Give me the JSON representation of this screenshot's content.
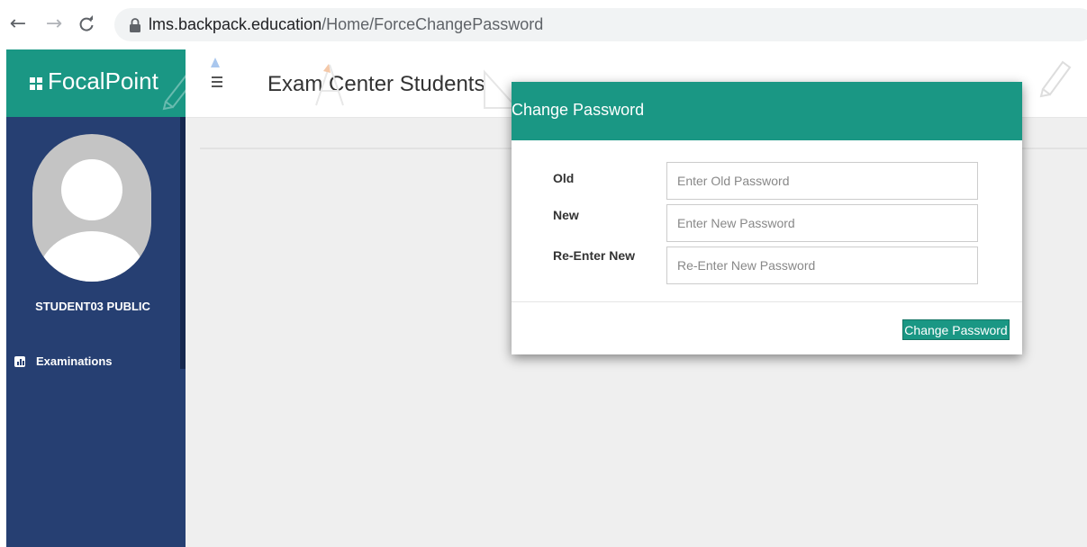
{
  "browser": {
    "url_host": "lms.backpack.education",
    "url_path": "/Home/ForceChangePassword",
    "back_icon": "arrow-left-icon",
    "forward_icon": "arrow-right-icon",
    "reload_icon": "reload-icon",
    "lock_icon": "lock-icon"
  },
  "brand": {
    "name": "FocalPoint",
    "icon": "grid-icon",
    "color": "#1a9784"
  },
  "sidebar": {
    "background": "#263f72",
    "student_name": "STUDENT03 PUBLIC",
    "items": [
      {
        "label": "Examinations",
        "icon": "bar-chart-icon"
      }
    ]
  },
  "header": {
    "title": "Exam Center Students",
    "menu_icon": "hamburger-icon"
  },
  "modal": {
    "title": "Change Password",
    "fields": [
      {
        "label": "Old",
        "value": "",
        "placeholder": "Enter Old Password"
      },
      {
        "label": "New",
        "value": "",
        "placeholder": "Enter New Password"
      },
      {
        "label": "Re-Enter New",
        "value": "",
        "placeholder": "Re-Enter New Password"
      }
    ],
    "submit_label": "Change Password"
  }
}
